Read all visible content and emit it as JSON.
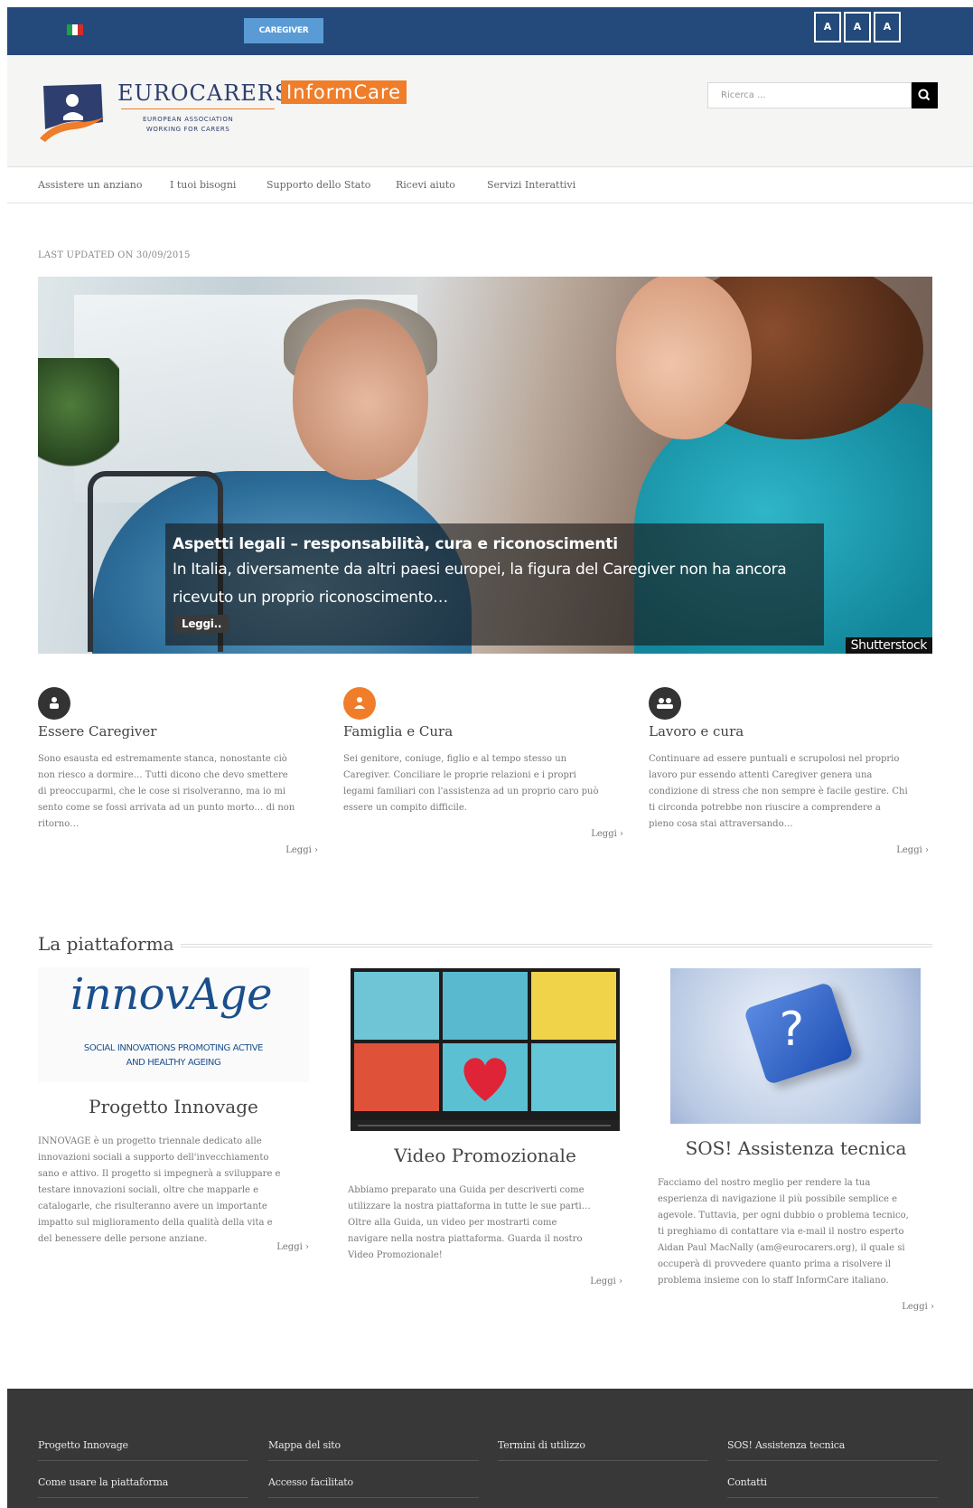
{
  "topbar": {
    "carer_button": "CAREGIVER",
    "font_sizes": [
      "A",
      "A",
      "A"
    ],
    "colors": {
      "bar": "#234a7a",
      "carer_button": "#5a9bd5"
    }
  },
  "header": {
    "logo_name": "EUROCARERS",
    "logo_product": "InformCare",
    "logo_subtitle_1": "EUROPEAN ASSOCIATION",
    "logo_subtitle_2": "WORKING FOR CARERS",
    "search_placeholder": "Ricerca ...",
    "colors": {
      "accent": "#ef7d2a",
      "brand": "#2e3e6e"
    }
  },
  "nav": {
    "items": [
      "Assistere un anziano",
      "I tuoi bisogni",
      "Supporto dello Stato",
      "Ricevi aiuto",
      "Servizi Interattivi"
    ]
  },
  "last_updated": "LAST UPDATED ON 30/09/2015",
  "hero": {
    "title": "Aspetti legali – responsabilità, cura e riconoscimenti",
    "text_1": "In Italia, diversamente da altri paesi europei, la figura del Caregiver non ha ancora",
    "text_2": "ricevuto un proprio riconoscimento…",
    "button": "Leggi..",
    "credit": "Shutterstock"
  },
  "features": [
    {
      "icon": "caregiver-icon",
      "title": "Essere Caregiver",
      "lines": [
        "Sono esausta ed estremamente stanca, nonostante ciò",
        "non riesco a dormire… Tutti dicono che devo smettere",
        "di preoccuparmi, che le cose si risolveranno, ma io mi",
        "sento come se fossi arrivata ad un punto morto… di non",
        "ritorno…"
      ],
      "more": "Leggi ›",
      "color": "#333333"
    },
    {
      "icon": "family-icon",
      "title": "Famiglia e Cura",
      "lines": [
        "Sei genitore, coniuge, figlio e al tempo stesso un",
        "Caregiver. Conciliare le proprie relazioni e i propri",
        "legami familiari con l'assistenza ad un proprio caro può",
        "essere un compito difficile."
      ],
      "more": "Leggi ›",
      "color": "#ef7d2a"
    },
    {
      "icon": "work-icon",
      "title": "Lavoro e cura",
      "lines": [
        "Continuare ad essere puntuali e scrupolosi nel proprio",
        "lavoro pur essendo attenti Caregiver genera una",
        "condizione di stress che non sempre è facile gestire. Chi",
        "ti circonda potrebbe non riuscire a comprendere a",
        "pieno cosa stai attraversando…"
      ],
      "more": "Leggi ›",
      "color": "#333333"
    }
  ],
  "platform": {
    "heading": "La piattaforma",
    "items": [
      {
        "logo_word": "innovAge",
        "logo_sub_1": "SOCIAL INNOVATIONS PROMOTING ACTIVE",
        "logo_sub_2": "AND HEALTHY AGEING",
        "title": "Progetto Innovage",
        "lines": [
          "INNOVAGE è un progetto triennale dedicato alle",
          "innovazioni sociali a supporto dell'invecchiamento",
          "sano e attivo. Il progetto si impegnerà a sviluppare e",
          "testare innovazioni sociali, oltre che mapparle e",
          "catalogarle, che risulteranno avere un importante",
          "impatto sul miglioramento della qualità della vita e",
          "del benessere delle persone anziane."
        ],
        "more": "Leggi ›"
      },
      {
        "title": "Video Promozionale",
        "lines": [
          "Abbiamo preparato una Guida per descriverti come",
          "utilizzare la nostra piattaforma in tutte le sue parti…",
          "Oltre alla Guida, un video per mostrarti come",
          "navigare nella nostra piattaforma. Guarda il nostro",
          "Video Promozionale!"
        ],
        "more": "Leggi ›"
      },
      {
        "title": "SOS! Assistenza tecnica",
        "key_label": "?",
        "lines": [
          "Facciamo del nostro meglio per rendere la tua",
          "esperienza di navigazione il più possibile semplice e",
          "agevole. Tuttavia, per ogni dubbio o problema tecnico,",
          "ti preghiamo di contattare via e-mail il nostro esperto",
          "Aidan Paul MacNally (am@eurocarers.org), il quale si",
          "occuperà di provvedere quanto prima a risolvere il",
          "problema insieme con lo staff InformCare italiano."
        ],
        "more": "Leggi ›"
      }
    ]
  },
  "footer": {
    "links": [
      "Progetto Innovage",
      "Mappa del sito",
      "Termini di utilizzo",
      "SOS! Assistenza tecnica",
      "Come usare la piattaforma",
      "Accesso facilitato",
      "Contatti"
    ],
    "color": "#383838"
  }
}
